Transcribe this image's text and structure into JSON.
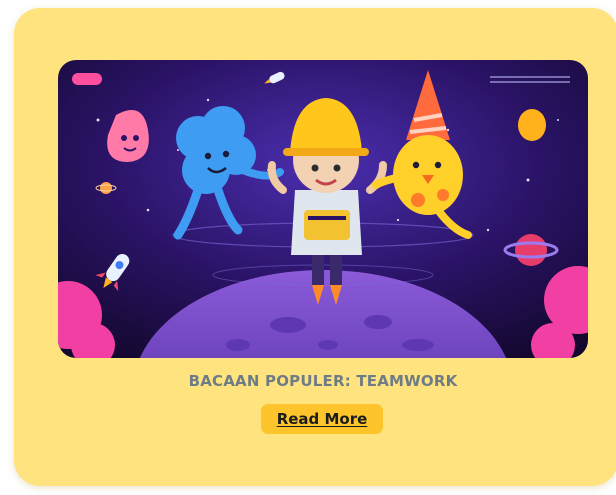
{
  "card": {
    "image": {
      "icon": "space-teamwork-illustration"
    },
    "caption": "BACAAN POPULER: TEAMWORK",
    "button_label": "Read More"
  },
  "colors": {
    "card_bg": "#ffe37e",
    "caption": "#6e7c86",
    "button_bg": "#fdc52b",
    "illustration_bg": "#2a1366"
  }
}
